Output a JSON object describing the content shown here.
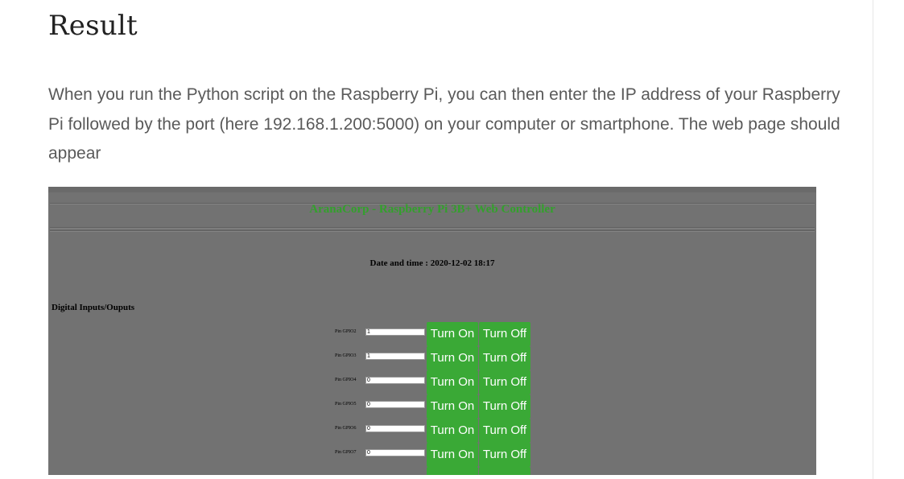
{
  "article": {
    "heading": "Result",
    "paragraph": "When you run the Python script on the Raspberry Pi, you can then enter the IP address of your Raspberry Pi followed by the port (here 192.168.1.200:5000) on your computer or smartphone. The web page should appear"
  },
  "screenshot": {
    "title": "AranaCorp - Raspberry Pi 3B+ Web Controller",
    "datetime": "Date and time : 2020-12-02 18:17",
    "section_label": "Digital Inputs/Ouputs",
    "turn_on_label": "Turn On",
    "turn_off_label": "Turn Off",
    "pins": [
      {
        "label": "Pin GPIO2",
        "value": "1"
      },
      {
        "label": "Pin GPIO3",
        "value": "1"
      },
      {
        "label": "Pin GPIO4",
        "value": "0"
      },
      {
        "label": "Pin GPIO5",
        "value": "0"
      },
      {
        "label": "Pin GPIO6",
        "value": "0"
      },
      {
        "label": "Pin GPIO7",
        "value": "0"
      }
    ],
    "colors": {
      "background": "#727272",
      "title": "#33a02c",
      "button": "#3aa936"
    }
  }
}
